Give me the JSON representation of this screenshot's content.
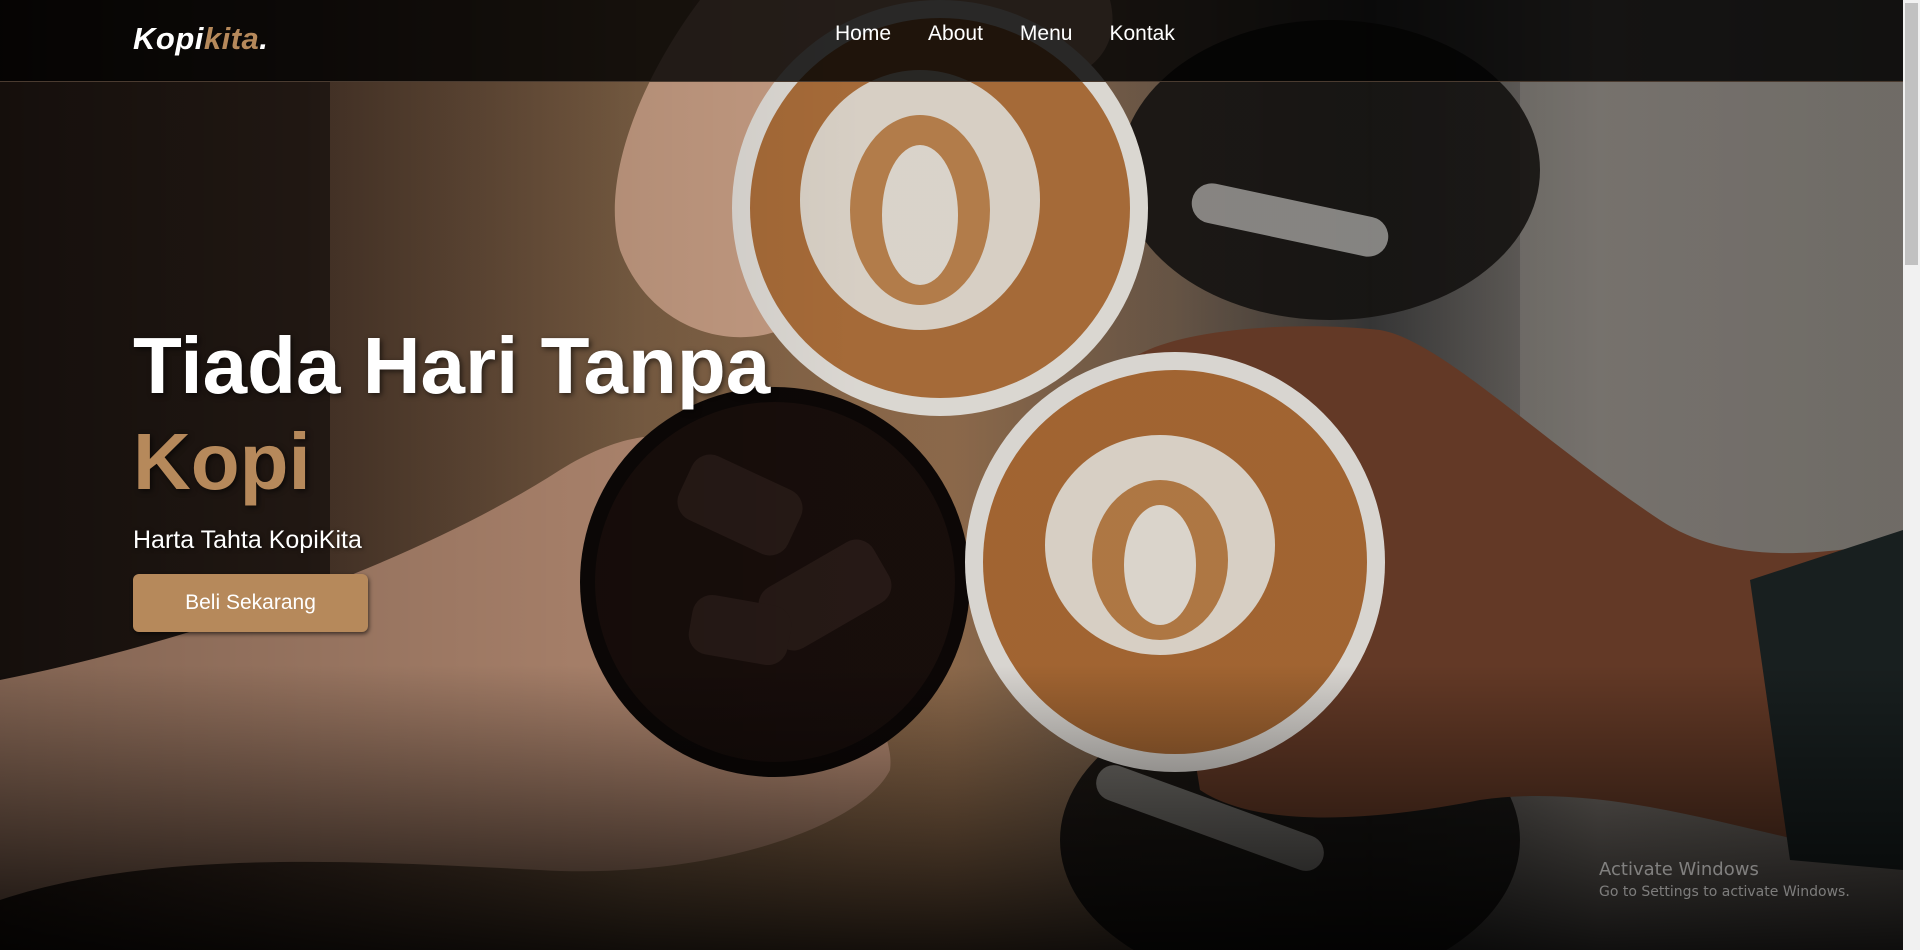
{
  "navbar": {
    "brand_main": "Kopi",
    "brand_accent": "kita",
    "brand_dot": ".",
    "links": [
      {
        "label": "Home"
      },
      {
        "label": "About"
      },
      {
        "label": "Menu"
      },
      {
        "label": "Kontak"
      }
    ]
  },
  "hero": {
    "title_line1": "Tiada Hari Tanpa",
    "title_accent": "Kopi",
    "subtitle": "Harta Tahta KopiKita",
    "cta_label": "Beli Sekarang",
    "background_image": "coffee-cups-cheers-photo"
  },
  "watermark": {
    "title": "Activate Windows",
    "subtitle": "Go to Settings to activate Windows."
  },
  "colors": {
    "accent": "#b6895b",
    "navbar_bg": "#0a0a0a",
    "text": "#ffffff"
  }
}
